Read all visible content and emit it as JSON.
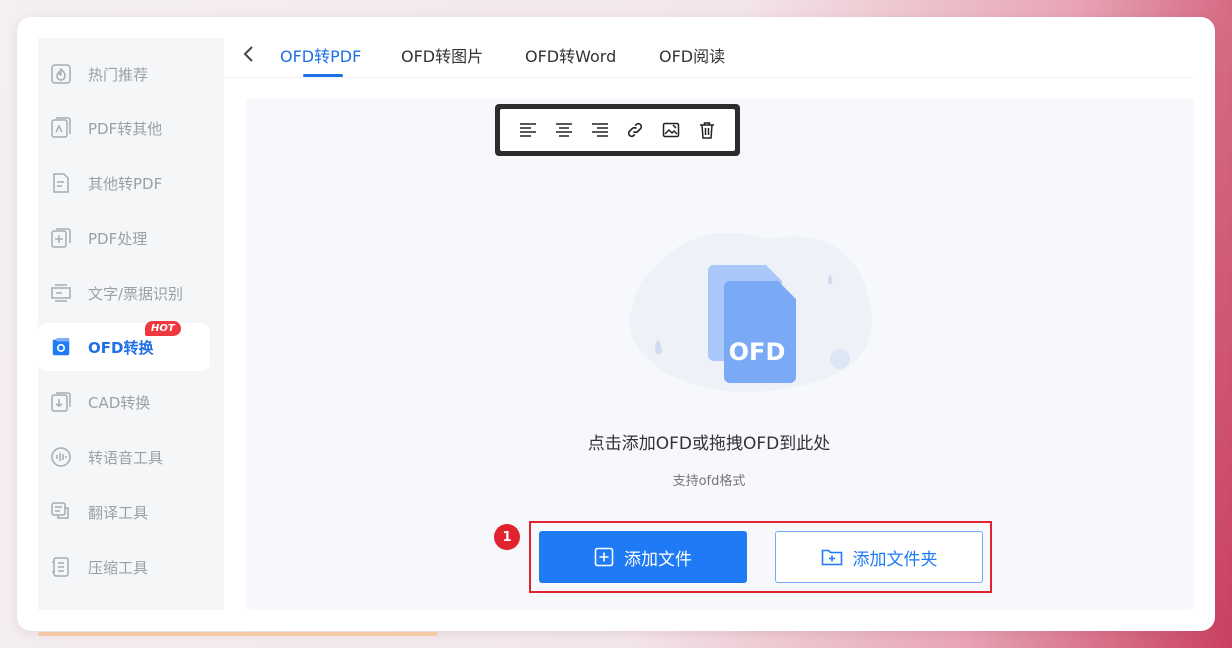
{
  "sidebar": {
    "items": [
      {
        "label": "热门推荐",
        "icon": "hot-recommend-icon",
        "active": false
      },
      {
        "label": "PDF转其他",
        "icon": "pdf-convert-icon",
        "active": false
      },
      {
        "label": "其他转PDF",
        "icon": "to-pdf-icon",
        "active": false
      },
      {
        "label": "PDF处理",
        "icon": "pdf-process-icon",
        "active": false
      },
      {
        "label": "文字/票据识别",
        "icon": "ocr-icon",
        "active": false
      },
      {
        "label": "OFD转换",
        "icon": "ofd-icon",
        "active": true,
        "badge": "HOT"
      },
      {
        "label": "CAD转换",
        "icon": "cad-icon",
        "active": false
      },
      {
        "label": "转语音工具",
        "icon": "voice-icon",
        "active": false
      },
      {
        "label": "翻译工具",
        "icon": "translate-icon",
        "active": false
      },
      {
        "label": "压缩工具",
        "icon": "compress-icon",
        "active": false
      }
    ]
  },
  "tabs": [
    {
      "label": "OFD转PDF",
      "active": true
    },
    {
      "label": "OFD转图片",
      "active": false
    },
    {
      "label": "OFD转Word",
      "active": false
    },
    {
      "label": "OFD阅读",
      "active": false
    }
  ],
  "toolbar": {
    "buttons": [
      "align-left-icon",
      "align-center-icon",
      "align-right-icon",
      "link-icon",
      "image-edit-icon",
      "delete-icon"
    ]
  },
  "dropzone": {
    "illustration_text": "OFD",
    "title": "点击添加OFD或拖拽OFD到此处",
    "subtitle": "支持ofd格式",
    "step_number": "1",
    "add_file_label": "添加文件",
    "add_folder_label": "添加文件夹"
  },
  "colors": {
    "accent": "#1f7af5",
    "highlight": "#e0232f",
    "hot_badge": "#f0383f"
  }
}
